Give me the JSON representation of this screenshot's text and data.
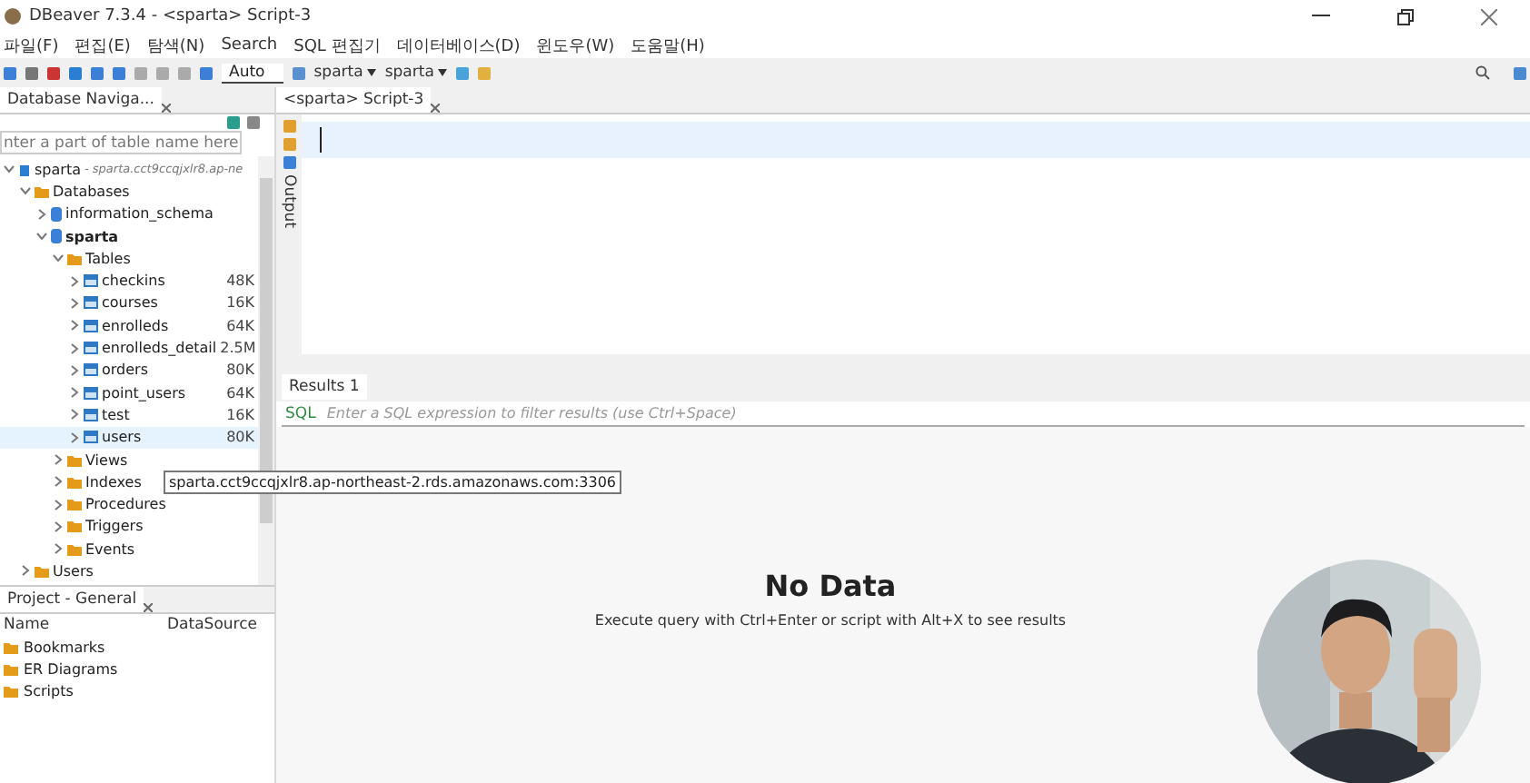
{
  "window": {
    "title": "DBeaver 7.3.4 - <sparta> Script-3"
  },
  "menu": [
    "파일(F)",
    "편집(E)",
    "탐색(N)",
    "Search",
    "SQL 편집기",
    "데이터베이스(D)",
    "윈도우(W)",
    "도움말(H)"
  ],
  "toolbar": {
    "commit_mode": "Auto",
    "datasource": "sparta",
    "schema": "sparta"
  },
  "navigator": {
    "tab": "Database Naviga...",
    "filter_placeholder": "nter a part of table name here",
    "tree": [
      {
        "label": "sparta",
        "kind": "connection",
        "detail": "- sparta.cct9ccqjxlr8.ap-ne",
        "expanded": true,
        "children": [
          {
            "label": "Databases",
            "kind": "folder",
            "expanded": true,
            "children": [
              {
                "label": "information_schema",
                "kind": "database",
                "expanded": false
              },
              {
                "label": "sparta",
                "kind": "database",
                "expanded": true,
                "children": [
                  {
                    "label": "Tables",
                    "kind": "folder",
                    "expanded": true,
                    "children": [
                      {
                        "label": "checkins",
                        "kind": "table",
                        "size": "48K",
                        "expanded": false,
                        "hovered": false
                      },
                      {
                        "label": "courses",
                        "kind": "table",
                        "size": "16K",
                        "expanded": false,
                        "hovered": false
                      },
                      {
                        "label": "enrolleds",
                        "kind": "table",
                        "size": "64K",
                        "expanded": false,
                        "hovered": false
                      },
                      {
                        "label": "enrolleds_detail",
                        "kind": "table",
                        "size": "2.5M",
                        "expanded": false,
                        "hovered": false
                      },
                      {
                        "label": "orders",
                        "kind": "table",
                        "size": "80K",
                        "expanded": false,
                        "hovered": false
                      },
                      {
                        "label": "point_users",
                        "kind": "table",
                        "size": "64K",
                        "expanded": false,
                        "hovered": false
                      },
                      {
                        "label": "test",
                        "kind": "table",
                        "size": "16K",
                        "expanded": false,
                        "hovered": false
                      },
                      {
                        "label": "users",
                        "kind": "table",
                        "size": "80K",
                        "expanded": false,
                        "hovered": true
                      }
                    ]
                  },
                  {
                    "label": "Views",
                    "kind": "folder",
                    "expanded": false
                  },
                  {
                    "label": "Indexes",
                    "kind": "folder",
                    "expanded": false
                  },
                  {
                    "label": "Procedures",
                    "kind": "folder",
                    "expanded": false
                  },
                  {
                    "label": "Triggers",
                    "kind": "folder",
                    "expanded": false
                  },
                  {
                    "label": "Events",
                    "kind": "folder",
                    "expanded": false
                  }
                ]
              }
            ]
          },
          {
            "label": "Users",
            "kind": "folder",
            "expanded": false
          }
        ]
      }
    ]
  },
  "tooltip": "sparta.cct9ccqjxlr8.ap-northeast-2.rds.amazonaws.com:3306",
  "project": {
    "tab": "Project - General",
    "columns": [
      "Name",
      "DataSource"
    ],
    "items": [
      "Bookmarks",
      "ER Diagrams",
      "Scripts"
    ]
  },
  "editor": {
    "tab": "<sparta> Script-3",
    "side_panel": "Output"
  },
  "results": {
    "tab": "Results 1",
    "filter_label": "SQL",
    "filter_placeholder": "Enter a SQL expression to filter results (use Ctrl+Space)",
    "empty_title": "No Data",
    "empty_hint": "Execute query with Ctrl+Enter or script with Alt+X to see results"
  }
}
